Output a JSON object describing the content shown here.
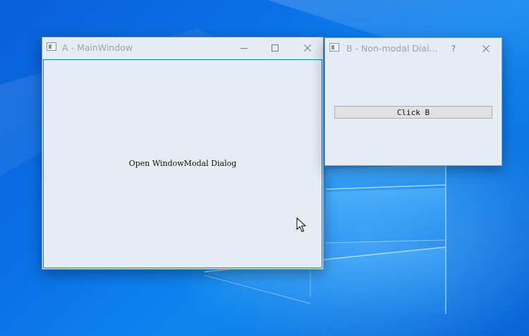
{
  "desktop": {
    "background_color": "#0b72e6"
  },
  "window_a": {
    "title": "A - MainWindow",
    "app_icon": "window-app-icon",
    "controls": {
      "minimize": "minimize-icon",
      "maximize": "maximize-icon",
      "close": "close-icon"
    },
    "content_label": "Open WindowModal Dialog"
  },
  "window_b": {
    "title": "B - Non-modal Dial...",
    "app_icon": "window-app-icon",
    "controls": {
      "help": "?",
      "close": "close-icon"
    },
    "button_label": "Click B"
  },
  "cursor": {
    "icon": "arrow-cursor-icon"
  }
}
